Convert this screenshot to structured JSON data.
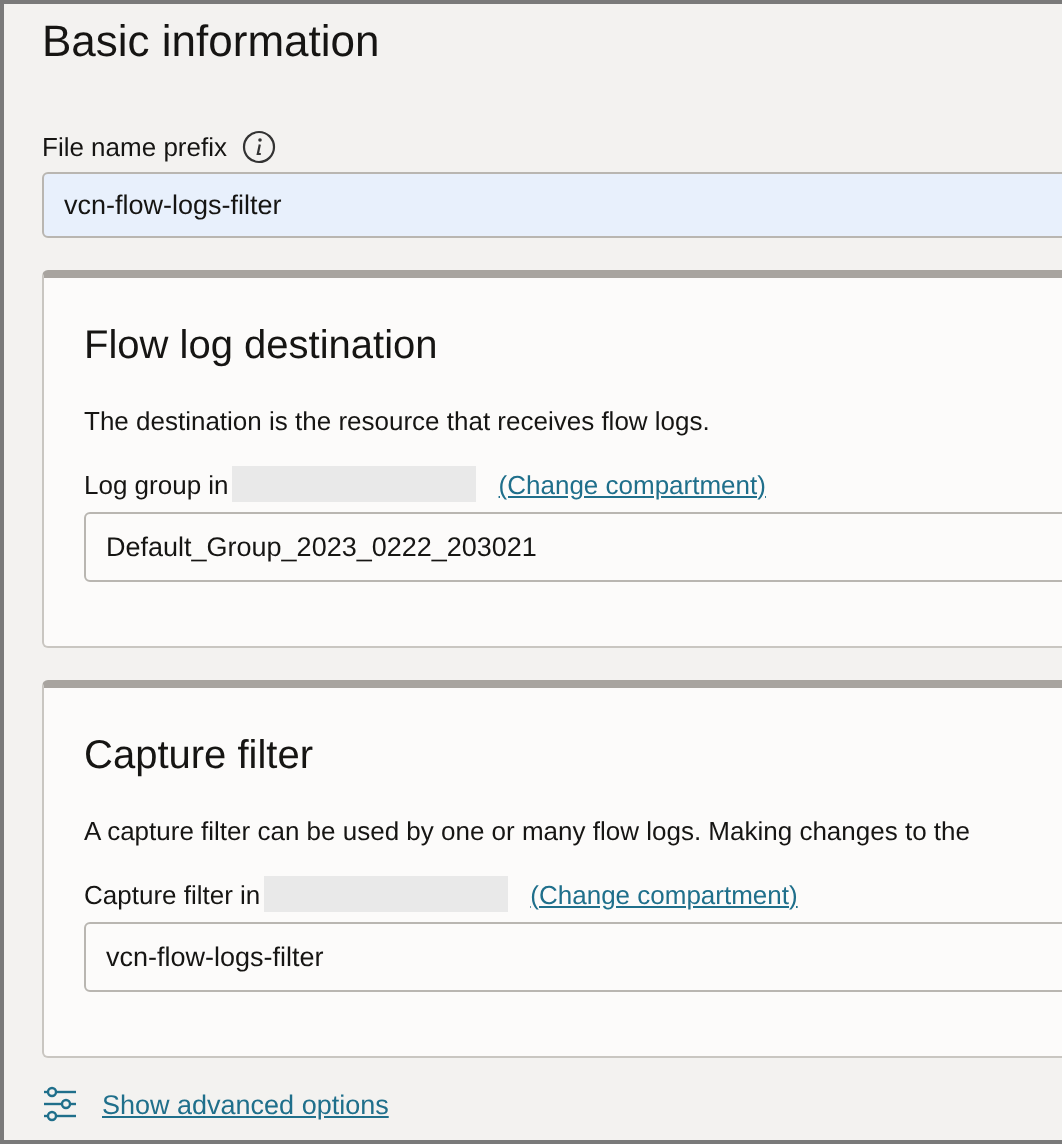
{
  "title": "Basic information",
  "file_name_prefix": {
    "label": "File name prefix",
    "value": "vcn-flow-logs-filter",
    "highlighted": true
  },
  "sections": [
    {
      "title": "Flow log destination",
      "description": "The destination is the resource that receives flow logs.",
      "field_label": "Log group in",
      "link": "(Change compartment)",
      "value": "Default_Group_2023_0222_203021"
    },
    {
      "title": "Capture filter",
      "description": "A capture filter can be used by one or many flow logs. Making changes to the",
      "field_label": "Capture filter in",
      "link": "(Change compartment)",
      "value": "vcn-flow-logs-filter"
    }
  ],
  "advanced_link": "Show advanced options"
}
